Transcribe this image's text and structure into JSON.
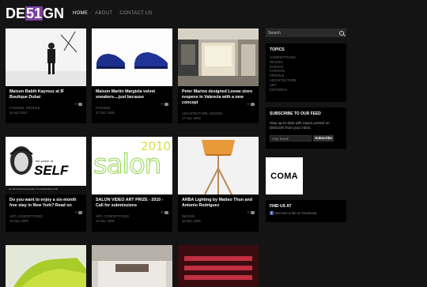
{
  "logo": {
    "part1": "DE",
    "part2": "51",
    "part3": "GN"
  },
  "nav": [
    {
      "label": "HOME",
      "active": true
    },
    {
      "label": "ABOUT",
      "active": false
    },
    {
      "label": "CONTACT US",
      "active": false
    }
  ],
  "search": {
    "placeholder": "Search"
  },
  "posts": [
    {
      "title": "Maison Rabih Kayrouz at IF Boutique Dubai",
      "meta": "FASHION, PROFILE",
      "date": "15 Apr 2010",
      "comments": "0"
    },
    {
      "title": "Maison Martin Margiela velvet sneakers....just because",
      "meta": "FASHION",
      "date": "27 Dec 2009",
      "comments": "0"
    },
    {
      "title": "Peter Marino designed Loewe store reopens in Valencia with a new concept",
      "meta": "ARCHITECTURE, DESIGN",
      "date": "17 Dec 2009",
      "comments": "0"
    },
    {
      "title": "Do you want to enjoy a six-month free stay in New York? Read on",
      "meta": "ART, COMPETITIONS",
      "date": "16 Dec 2009",
      "comments": "0"
    },
    {
      "title": "SALON VIDEO ART PRIZE - 2010 - Call for submissions",
      "meta": "ART, COMPETITIONS",
      "date": "16 Dec 2009",
      "comments": "0"
    },
    {
      "title": "ARBA Lighting by Matteo Thun and Antonio Rodriguez",
      "meta": "DESIGN",
      "date": "16 Dec 2009",
      "comments": "0"
    }
  ],
  "self_image": {
    "word": "SELF",
    "small": "the power of",
    "caption": "the self-centered personality in an individualistic world"
  },
  "salon_image": {
    "word": "salon",
    "year": "2010"
  },
  "topics": {
    "heading": "TOPICS",
    "items": [
      "COMPETITIONS",
      "DESIGN",
      "EVENTS",
      "FASHION",
      "PROFILE",
      "ARCHITECTURE",
      "ART",
      "EDITORIAL"
    ]
  },
  "subscribe": {
    "heading": "SUBSCRIBE TO OUR FEED",
    "text": "Stay up-to-date with topics posted on DE51GN from your inbox.",
    "email_placeholder": "Your Email",
    "button": "Subscribe"
  },
  "ad": {
    "label": "COMA"
  },
  "findus": {
    "heading": "FIND US AT",
    "fb_icon": "f",
    "link": "Become a fan on Facebook"
  }
}
